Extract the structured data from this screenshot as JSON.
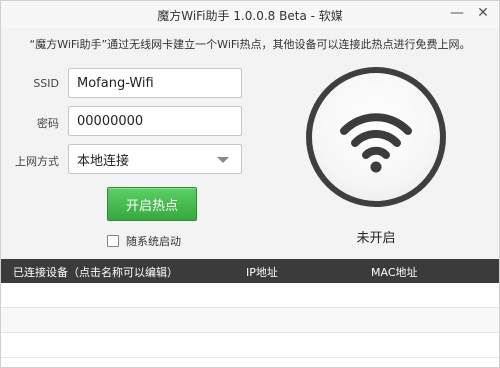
{
  "window": {
    "title": "魔方WiFi助手 1.0.0.8 Beta - 软媒",
    "minimize_glyph": "—",
    "close_glyph": "✕"
  },
  "notice": "“魔方WiFi助手”通过无线网卡建立一个WiFi热点，其他设备可以连接此热点进行免费上网。",
  "form": {
    "ssid_label": "SSID",
    "ssid_value": "Mofang-Wifi",
    "password_label": "密码",
    "password_value": "00000000",
    "network_label": "上网方式",
    "network_value": "本地连接"
  },
  "start_button_label": "开启热点",
  "autostart_label": "随系统启动",
  "autostart_checked": false,
  "hotspot_status": "未开启",
  "icons": {
    "status": "wifi-icon",
    "dropdown": "chevron-down-icon"
  },
  "colors": {
    "start_button": "#3ab543",
    "table_header": "#3b3b3b",
    "wifi_ring": "#3f3f3f",
    "wifi_symbol": "#3c3c3c"
  },
  "devices_table": {
    "columns": [
      "已连接设备（点击名称可以编辑）",
      "IP地址",
      "MAC地址"
    ],
    "rows": []
  }
}
